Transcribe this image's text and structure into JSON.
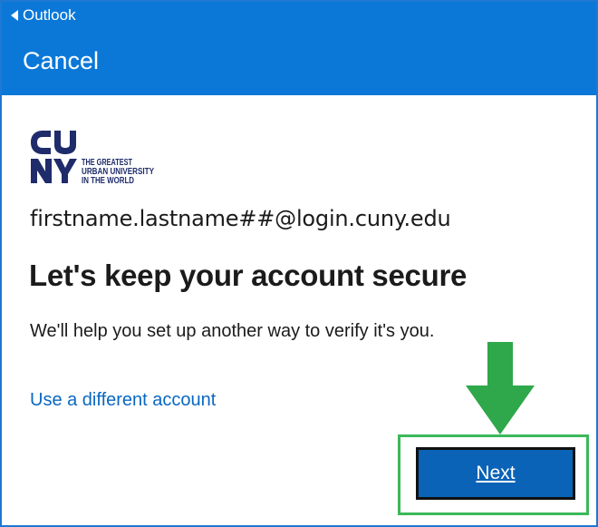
{
  "header": {
    "back_label": "Outlook",
    "cancel_label": "Cancel",
    "color": "#0b78d8"
  },
  "logo": {
    "text": "CUNY",
    "tagline": [
      "THE GREATEST",
      "URBAN UNIVERSITY",
      "IN THE WORLD"
    ],
    "color": "#1f2c6b"
  },
  "account": {
    "email": "firstname.lastname##@login.cuny.edu"
  },
  "main": {
    "headline": "Let's keep your account secure",
    "description": "We'll help you set up another way to verify it's you.",
    "alt_link": "Use a different account",
    "link_color": "#0a67c2"
  },
  "actions": {
    "next_label": "Next",
    "next_color": "#0a63b6"
  },
  "annotation": {
    "arrow_color": "#2ea84a",
    "highlight_color": "#3cb85a"
  }
}
